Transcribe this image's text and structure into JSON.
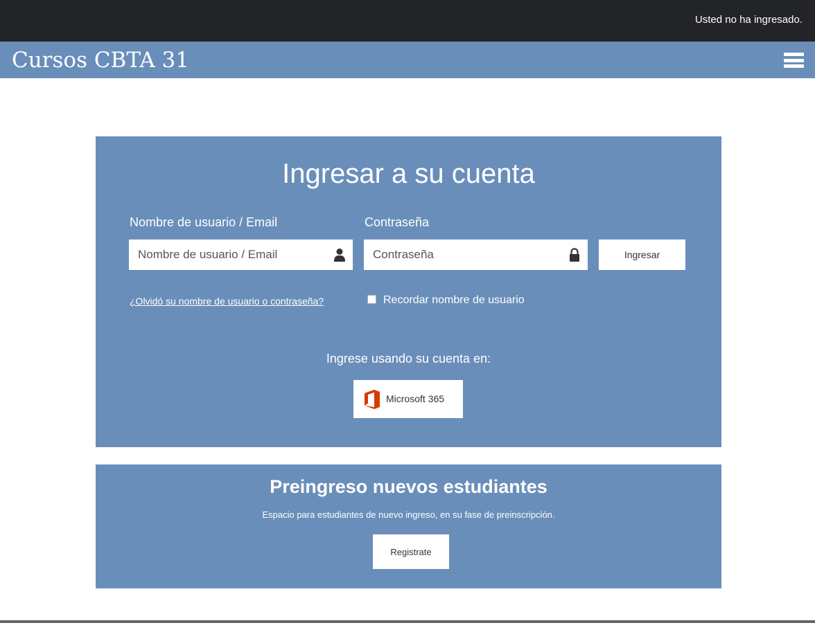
{
  "topbar": {
    "login_status": "Usted no ha ingresado."
  },
  "navbar": {
    "site_title": "Cursos CBTA 31",
    "menu_icon": "hamburger-menu-icon"
  },
  "login": {
    "heading": "Ingresar a su cuenta",
    "username_label": "Nombre de usuario / Email",
    "username_placeholder": "Nombre de usuario / Email",
    "username_icon": "user-icon",
    "password_label": "Contraseña",
    "password_placeholder": "Contraseña",
    "password_icon": "lock-icon",
    "submit_label": "Ingresar",
    "forgot_link": "¿Olvidó su nombre de usuario o contraseña?",
    "remember_label": "Recordar nombre de usuario",
    "sso_prompt": "Ingrese usando su cuenta en:",
    "sso_button_label": "Microsoft 365",
    "sso_icon": "microsoft-office-icon"
  },
  "signup": {
    "heading": "Preingreso nuevos estudiantes",
    "description": "Espacio para estudiantes de nuevo ingreso, en su fase de preinscripción.",
    "button_label": "Registrate"
  },
  "colors": {
    "topbar": "#232428",
    "accent_blue": "#6a8eba",
    "office_orange": "#d83b01"
  }
}
